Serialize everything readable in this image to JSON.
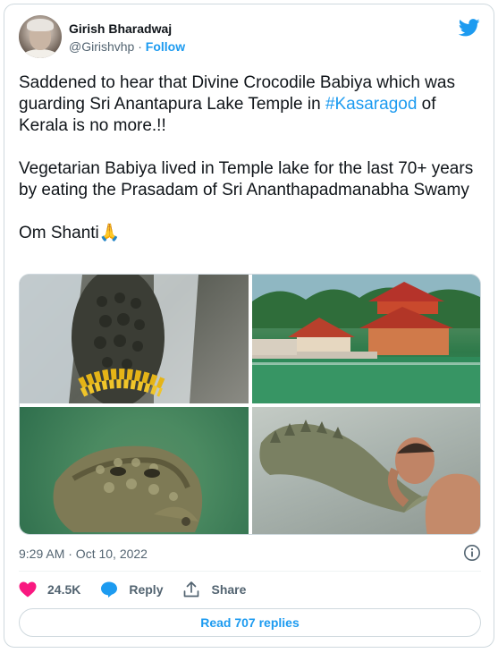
{
  "author": {
    "name": "Girish Bharadwaj",
    "handle": "@Girishvhp",
    "separator": " · ",
    "follow_label": "Follow"
  },
  "tweet": {
    "line1_before": "Saddened to hear that Divine Crocodile Babiya which was guarding Sri Anantapura Lake Temple in ",
    "hashtag": "#Kasaragod",
    "line1_after": " of Kerala is no more.!!",
    "paragraph2": "Vegetarian Babiya lived in Temple lake for the last 70+ years by eating the Prasadam of Sri Ananthapadmanabha Swamy",
    "paragraph3": "Om Shanti",
    "emoji": "🙏"
  },
  "media": [
    {
      "subject": "crocodile-with-marigold-garland"
    },
    {
      "subject": "anantapura-lake-temple"
    },
    {
      "subject": "crocodile-in-water"
    },
    {
      "subject": "priest-feeding-crocodile"
    }
  ],
  "meta": {
    "timestamp": "9:29 AM · Oct 10, 2022"
  },
  "actions": {
    "like_count": "24.5K",
    "reply_label": "Reply",
    "share_label": "Share"
  },
  "read_replies_label": "Read 707 replies",
  "colors": {
    "accent": "#1d9bf0",
    "like": "#f91880",
    "text": "#0f1419",
    "secondary": "#536471",
    "border": "#cfd9de"
  },
  "icons": [
    "twitter-bird-icon",
    "info-icon",
    "heart-icon",
    "reply-bubble-icon",
    "share-upload-icon"
  ]
}
